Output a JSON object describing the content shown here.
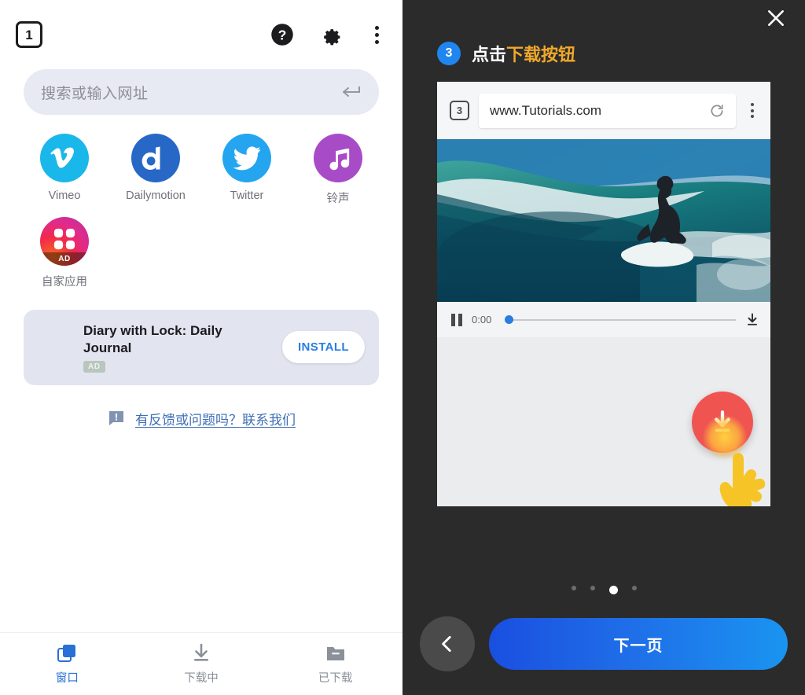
{
  "browser": {
    "topbar": {
      "tab_count": "1",
      "help_icon": "help-circle-icon",
      "settings_icon": "gear-icon",
      "menu_icon": "kebab-menu-icon"
    },
    "search": {
      "placeholder": "搜索或输入网址",
      "value": "",
      "enter_icon": "enter-return-icon"
    },
    "shortcuts": [
      {
        "label": "Vimeo",
        "icon": "vimeo-icon",
        "color": "#1ab7ea"
      },
      {
        "label": "Dailymotion",
        "icon": "dailymotion-icon",
        "color": "#2768c7"
      },
      {
        "label": "Twitter",
        "icon": "twitter-icon",
        "color": "#25a5f0"
      },
      {
        "label": "铃声",
        "icon": "music-note-icon",
        "color": "#a84bc7"
      },
      {
        "label": "自家应用",
        "icon": "house-apps-icon",
        "color": "#e02a8e",
        "badge": "AD"
      }
    ],
    "ad_card": {
      "title": "Diary with Lock: Daily Journal",
      "tag": "AD",
      "install_label": "INSTALL",
      "install_color": "#2a7de1"
    },
    "feedback": {
      "icon": "feedback-bubble-icon",
      "text": "有反馈或问题吗？联系我们",
      "color": "#3f6fb5"
    },
    "bottom_nav": {
      "active_color": "#2a6fd6",
      "inactive_color": "#8b9099",
      "items": [
        {
          "label": "窗口",
          "icon": "windows-stack-icon",
          "active": true
        },
        {
          "label": "下载中",
          "icon": "download-arrow-icon",
          "active": false
        },
        {
          "label": "已下载",
          "icon": "folder-done-icon",
          "active": false
        }
      ]
    }
  },
  "tutorial": {
    "close_icon": "close-x-icon",
    "background": "#2b2b2b",
    "step": {
      "number": "3",
      "number_color": "#1f86f0",
      "title_plain": "点击",
      "title_highlight": "下载按钮",
      "highlight_color": "#f0a82b"
    },
    "mock": {
      "tab_count": "3",
      "url": "www.Tutorials.com",
      "reload_icon": "reload-icon",
      "menu_icon": "kebab-menu-icon",
      "video_alt": "surfer-riding-wave",
      "player": {
        "state_icon": "pause-icon",
        "time": "0:00",
        "progress_percent": 0,
        "download_icon": "download-arrow-icon"
      },
      "fab": {
        "icon": "download-fab-icon",
        "color": "#f05451",
        "pointer_icon": "tap-hand-icon"
      }
    },
    "pagination": {
      "total": 4,
      "active_index": 2
    },
    "actions": {
      "back_icon": "chevron-left-icon",
      "next_label": "下一页",
      "next_gradient_from": "#1a4fe0",
      "next_gradient_to": "#1a94f0"
    }
  }
}
